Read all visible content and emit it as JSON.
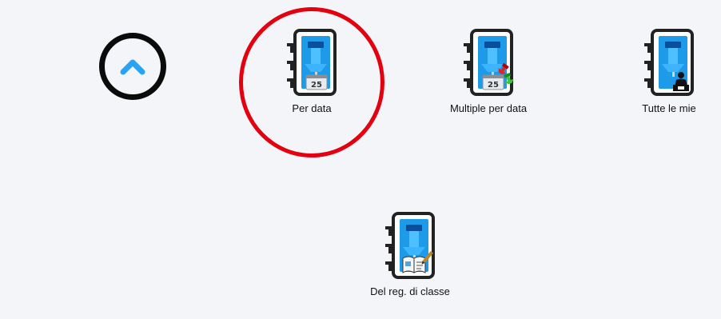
{
  "navigation": {
    "scroll_up_icon": "chevron-up-icon",
    "accent_color": "#2aa3f4"
  },
  "options": [
    {
      "label": "Per data",
      "icon": "planner-pin-calendar-icon",
      "date_badge": "25"
    },
    {
      "label": "Multiple per data",
      "icon": "planner-pin-calendar-multiple-icon",
      "date_badge": "25"
    },
    {
      "label": "Tutte le mie",
      "icon": "planner-pin-teacher-icon"
    },
    {
      "label": "Del reg. di classe",
      "icon": "planner-pin-class-register-icon"
    }
  ],
  "highlight": {
    "target": "Per data",
    "color": "#e3000f"
  }
}
